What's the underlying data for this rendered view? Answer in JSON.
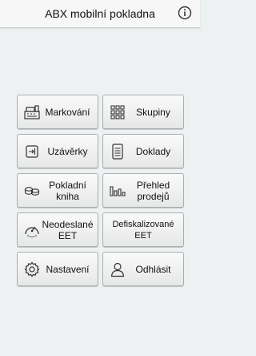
{
  "header": {
    "title": "ABX mobilní pokladna",
    "info_icon": "info-circle-icon"
  },
  "menu": [
    {
      "id": "markovani",
      "label": "Markování",
      "icon": "cash-register-icon"
    },
    {
      "id": "skupiny",
      "label": "Skupiny",
      "icon": "grid-icon"
    },
    {
      "id": "uzaverky",
      "label": "Uzávěrky",
      "icon": "closing-icon"
    },
    {
      "id": "doklady",
      "label": "Doklady",
      "icon": "document-icon"
    },
    {
      "id": "pokladni-kniha",
      "label": "Pokladní\nkniha",
      "icon": "coins-icon"
    },
    {
      "id": "prehled-prodeju",
      "label": "Přehled\nprodejů",
      "icon": "bar-chart-icon"
    },
    {
      "id": "neodeslane-eet",
      "label": "Neodeslané\nEET",
      "icon": "gauge-icon"
    },
    {
      "id": "defiskalizovane-eet",
      "label": "Defiskalizované\nEET",
      "icon": "none"
    },
    {
      "id": "nastaveni",
      "label": "Nastavení",
      "icon": "gear-icon"
    },
    {
      "id": "odhlasit",
      "label": "Odhlásit",
      "icon": "user-icon"
    }
  ]
}
